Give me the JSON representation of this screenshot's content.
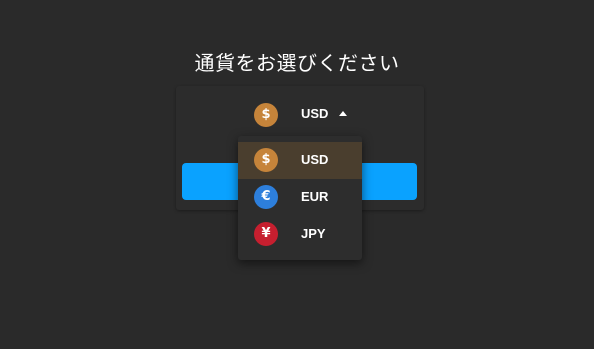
{
  "dialog": {
    "title": "通貨をお選びください"
  },
  "selector": {
    "selected_code": "USD",
    "selected_symbol": "$",
    "selected_color": "#c6843a",
    "caret_icon": "caret-up-icon"
  },
  "confirm_button": {
    "label": ""
  },
  "menu": {
    "items": [
      {
        "code": "USD",
        "symbol": "$",
        "color": "#c6843a",
        "icon": "dollar-coin-icon",
        "selected": true
      },
      {
        "code": "EUR",
        "symbol": "€",
        "color": "#2d7fdc",
        "icon": "euro-coin-icon",
        "selected": false
      },
      {
        "code": "JPY",
        "symbol": "¥",
        "color": "#c61f2f",
        "icon": "yen-coin-icon",
        "selected": false
      }
    ]
  },
  "colors": {
    "background": "#2a2a2a",
    "accent_button": "#0aa2ff",
    "selected_row": "#4a3e2e"
  }
}
